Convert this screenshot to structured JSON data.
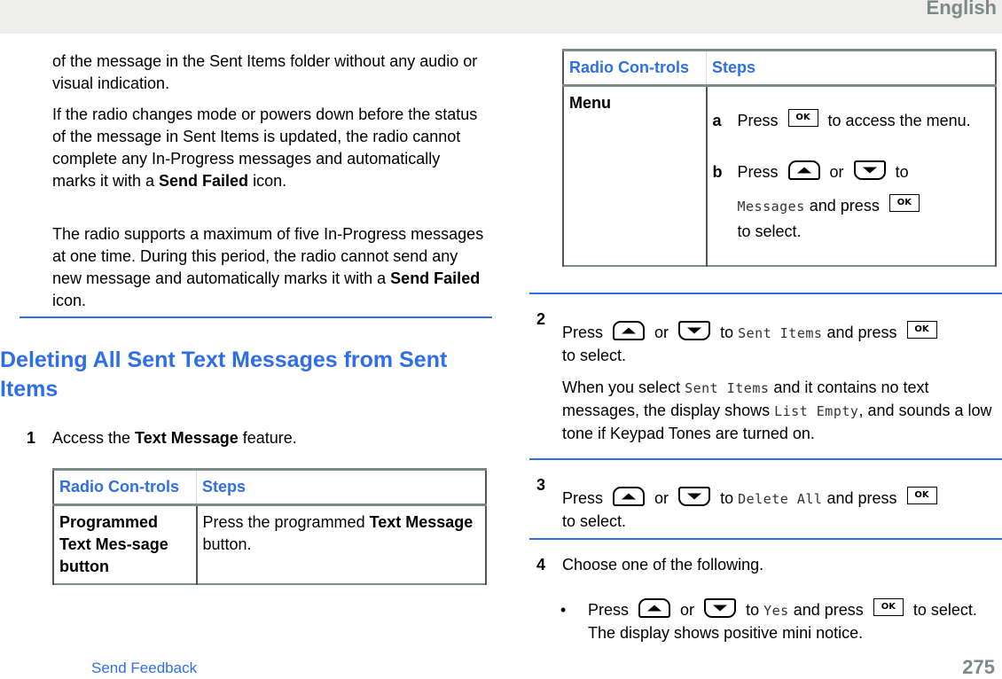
{
  "header": {
    "language": "English"
  },
  "left_column": {
    "para1": "of the message in the Sent Items folder without any audio or visual indication.",
    "para2_a": "If the radio changes mode or powers down before the status of the message in Sent Items is updated, the radio cannot complete any In-Progress messages and automatically marks it with a ",
    "para2_bold": "Send Failed",
    "para2_b": " icon.",
    "para3_a": "The radio supports a maximum of five In-Progress messages at one time. During this period, the radio cannot send any new message and automatically marks it with a ",
    "para3_bold": "Send Failed",
    "para3_b": " icon.",
    "heading": "Deleting All Sent Text Messages from Sent Items",
    "step1": {
      "number": "1",
      "text_a": "Access the ",
      "text_bold": "Text Message",
      "text_b": " feature."
    },
    "table1": {
      "headers": [
        "Radio Con-trols",
        "Steps"
      ],
      "row": {
        "control": "Programmed Text Mes-sage button",
        "steps_a": "Press the programmed ",
        "steps_bold": "Text Message",
        "steps_b": " button."
      }
    }
  },
  "right_column": {
    "table2": {
      "headers": [
        "Radio Con-trols",
        "Steps"
      ],
      "row": {
        "control": "Menu",
        "sub_a": {
          "label": "a",
          "press": "Press",
          "key": "OK",
          "rest": "to access the menu."
        },
        "sub_b": {
          "label": "b",
          "press": "Press",
          "or": "or",
          "to": "to",
          "target": "Messages",
          "and_press": "and press",
          "key": "OK",
          "rest": "to select."
        }
      }
    },
    "step2": {
      "number": "2",
      "press": "Press",
      "or": "or",
      "to": "to",
      "target": "Sent Items",
      "and_press": "and press",
      "key": "OK",
      "rest": "to select.",
      "note_a": "When you select ",
      "note_mono1": "Sent Items",
      "note_b": " and it contains no text messages, the display shows ",
      "note_mono2": "List Empty",
      "note_c": ", and sounds a low tone if Keypad Tones are turned on."
    },
    "step3": {
      "number": "3",
      "press": "Press",
      "or": "or",
      "to": "to",
      "target": "Delete All",
      "and_press": "and press",
      "key": "OK",
      "rest": "to select."
    },
    "step4": {
      "number": "4",
      "text": "Choose one of the following.",
      "bullet": {
        "marker": "•",
        "press": "Press",
        "or": "or",
        "to": "to",
        "target": "Yes",
        "and_press": "and press",
        "key": "OK",
        "rest": "to select. The display shows positive mini notice."
      }
    }
  },
  "footer": {
    "feedback_link": "Send Feedback",
    "page_number": "275"
  },
  "colors": {
    "accent": "#2e6fe6",
    "gray": "#7c8a8a",
    "header_bg": "#eeeeec"
  }
}
